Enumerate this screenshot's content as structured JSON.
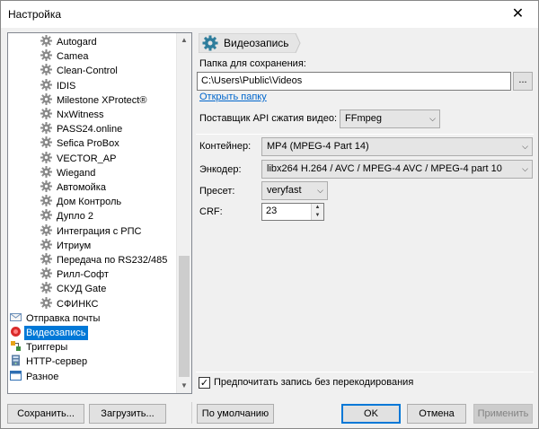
{
  "window": {
    "title": "Настройка",
    "close_glyph": "✕"
  },
  "tree": {
    "items": [
      {
        "label": "Autogard",
        "icon": "gear-icon"
      },
      {
        "label": "Camea",
        "icon": "gear-icon"
      },
      {
        "label": "Clean-Control",
        "icon": "gear-icon"
      },
      {
        "label": "IDIS",
        "icon": "gear-icon"
      },
      {
        "label": "Milestone XProtect®",
        "icon": "gear-icon"
      },
      {
        "label": "NxWitness",
        "icon": "gear-icon"
      },
      {
        "label": "PASS24.online",
        "icon": "gear-icon"
      },
      {
        "label": "Sefica ProBox",
        "icon": "gear-icon"
      },
      {
        "label": "VECTOR_AP",
        "icon": "gear-icon"
      },
      {
        "label": "Wiegand",
        "icon": "gear-icon"
      },
      {
        "label": "Автомойка",
        "icon": "gear-icon"
      },
      {
        "label": "Дом Контроль",
        "icon": "gear-icon"
      },
      {
        "label": "Дупло 2",
        "icon": "gear-icon"
      },
      {
        "label": "Интеграция с РПС",
        "icon": "gear-icon"
      },
      {
        "label": "Итриум",
        "icon": "gear-icon"
      },
      {
        "label": "Передача по RS232/485",
        "icon": "gear-icon"
      },
      {
        "label": "Рилл-Софт",
        "icon": "gear-icon"
      },
      {
        "label": "СКУД Gate",
        "icon": "gear-icon"
      },
      {
        "label": "СФИНКС",
        "icon": "gear-icon"
      },
      {
        "label": "Отправка почты",
        "icon": "mail-icon"
      },
      {
        "label": "Видеозапись",
        "icon": "video-record-icon",
        "selected": true
      },
      {
        "label": "Триггеры",
        "icon": "trigger-icon"
      },
      {
        "label": "HTTP-сервер",
        "icon": "server-icon"
      },
      {
        "label": "Разное",
        "icon": "window-icon"
      }
    ],
    "scroll_up": "▲",
    "scroll_down": "▼"
  },
  "section": {
    "title": "Видеозапись",
    "icon": "gear-icon"
  },
  "form": {
    "save_folder_label": "Папка для сохранения:",
    "save_folder_value": "C:\\Users\\Public\\Videos",
    "browse_label": "...",
    "open_folder_link": "Открыть папку",
    "api_provider_label": "Поставщик API сжатия видео:",
    "api_provider_value": "FFmpeg",
    "container_label": "Контейнер:",
    "container_value": "MP4 (MPEG-4 Part 14)",
    "encoder_label": "Энкодер:",
    "encoder_value": "libx264 H.264 / AVC / MPEG-4 AVC / MPEG-4 part 10",
    "preset_label": "Пресет:",
    "preset_value": "veryfast",
    "crf_label": "CRF:",
    "crf_value": "23",
    "prefer_no_recode_label": "Предпочитать запись без перекодирования",
    "prefer_no_recode_checked": true,
    "check_glyph": "✓",
    "dropdown_glyph": "⌵"
  },
  "buttons": {
    "save": "Сохранить...",
    "load": "Загрузить...",
    "defaults": "По умолчанию",
    "ok": "OK",
    "cancel": "Отмена",
    "apply": "Применить"
  }
}
